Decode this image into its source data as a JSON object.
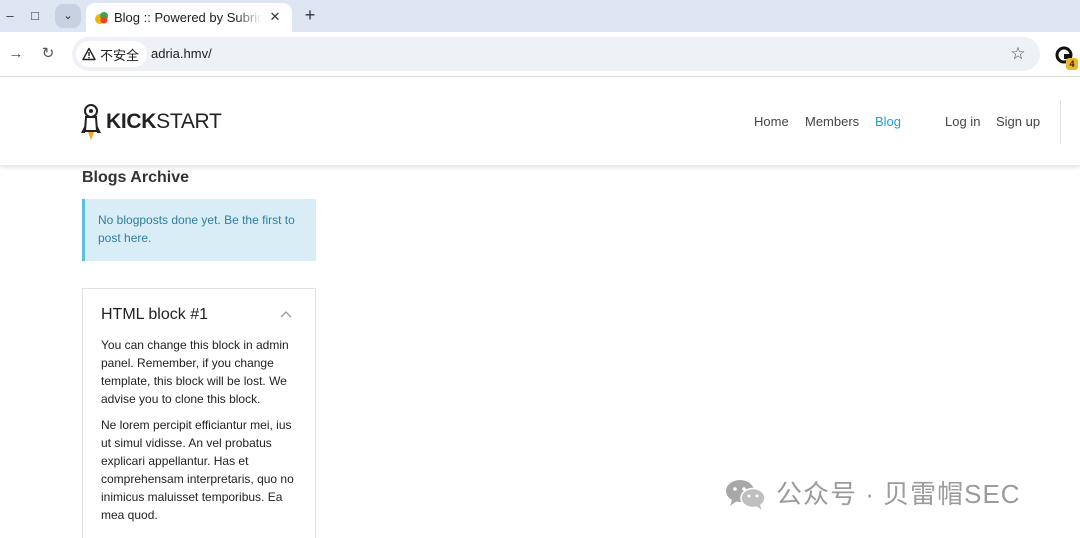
{
  "browser": {
    "tab_title": "Blog :: Powered by Subrion",
    "security_label": "不安全",
    "url": "adria.hmv/",
    "extension_badge": "4",
    "window_minimize": "–",
    "window_restore": "□",
    "tab_list": "⌄",
    "tab_close": "✕",
    "new_tab": "+",
    "forward": "→",
    "reload": "↻",
    "bookmark": "☆"
  },
  "site": {
    "logo_bold": "KICK",
    "logo_light": "START",
    "nav": {
      "home": "Home",
      "members": "Members",
      "blog": "Blog",
      "login": "Log in",
      "signup": "Sign up"
    },
    "accent_color": "#17a2d8"
  },
  "content": {
    "archive_title": "Blogs Archive",
    "alert_text": "No blogposts done yet. Be the first to post here.",
    "block": {
      "title": "HTML block #1",
      "paragraph1": "You can change this block in admin panel. Remember, if you change template, this block will be lost. We advise you to clone this block.",
      "paragraph2": "Ne lorem percipit efficiantur mei, ius ut simul vidisse. An vel probatus explicari appellantur. Has et comprehensam interpretaris, quo no inimicus maluisset temporibus. Ea mea quod."
    }
  },
  "watermark": {
    "text": "公众号 · 贝雷帽SEC"
  }
}
